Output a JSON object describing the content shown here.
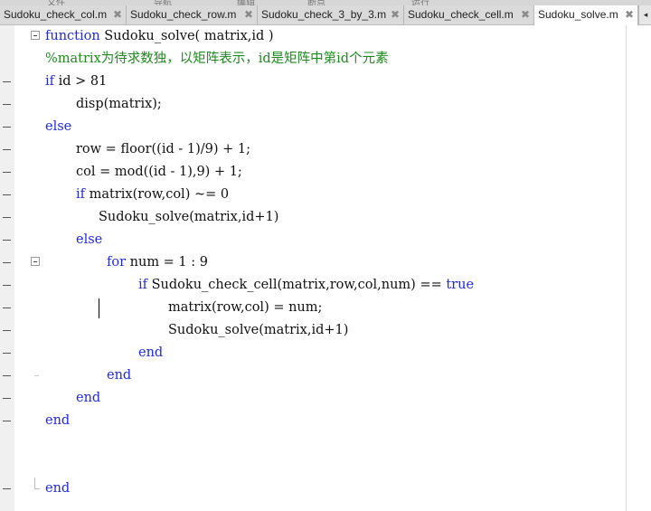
{
  "menu_strip": [
    "文件",
    "导航",
    "编辑",
    "断点",
    "运行"
  ],
  "tabs": [
    {
      "label": "Sudoku_check_col.m",
      "active": false
    },
    {
      "label": "Sudoku_check_row.m",
      "active": false
    },
    {
      "label": "Sudoku_check_3_by_3.m",
      "active": false
    },
    {
      "label": "Sudoku_check_cell.m",
      "active": false
    },
    {
      "label": "Sudoku_solve.m",
      "active": true
    }
  ],
  "close_glyph": "✖",
  "tab_scroll_glyph": "◂",
  "colors": {
    "keyword": "#1f2ae0",
    "comment": "#1f8a1f",
    "text": "#111111",
    "tab_active_bg": "#ffffff",
    "tab_bg": "#dadada"
  },
  "code_lines": [
    {
      "indent": 0,
      "kw": "function",
      "text": " Sudoku_solve( matrix,id )"
    },
    {
      "indent": 0,
      "comment": "%matrix为待求数独，以矩阵表示，id是矩阵中第id个元素"
    },
    {
      "indent": 0,
      "kw": "if",
      "text": " id > 81"
    },
    {
      "indent": 1,
      "text": "disp(matrix);"
    },
    {
      "indent": 0,
      "kw": "else"
    },
    {
      "indent": 1,
      "text": "row = floor((id - 1)/9) + 1;"
    },
    {
      "indent": 1,
      "text": "col = mod((id - 1),9) + 1;"
    },
    {
      "indent": 1,
      "kw": "if",
      "text": " matrix(row,col) ~= 0"
    },
    {
      "indent": 2,
      "text": "Sudoku_solve(matrix,id+1)"
    },
    {
      "indent": 1,
      "kw": "else"
    },
    {
      "indent": 3,
      "kw": "for",
      "text": " num = 1 : 9"
    },
    {
      "indent": 4,
      "kw": "if",
      "text": " Sudoku_check_cell(matrix,row,col,num) == ",
      "kw2": "true"
    },
    {
      "indent": 5,
      "text": "matrix(row,col) = num;"
    },
    {
      "indent": 5,
      "text": "Sudoku_solve(matrix,id+1)"
    },
    {
      "indent": 4,
      "kw": "end"
    },
    {
      "indent": 3,
      "kw": "end"
    },
    {
      "indent": 1,
      "kw": "end"
    },
    {
      "indent": 0,
      "kw": "end"
    },
    {
      "indent": 0
    },
    {
      "indent": 0
    },
    {
      "indent": 0,
      "kw": "end"
    }
  ]
}
